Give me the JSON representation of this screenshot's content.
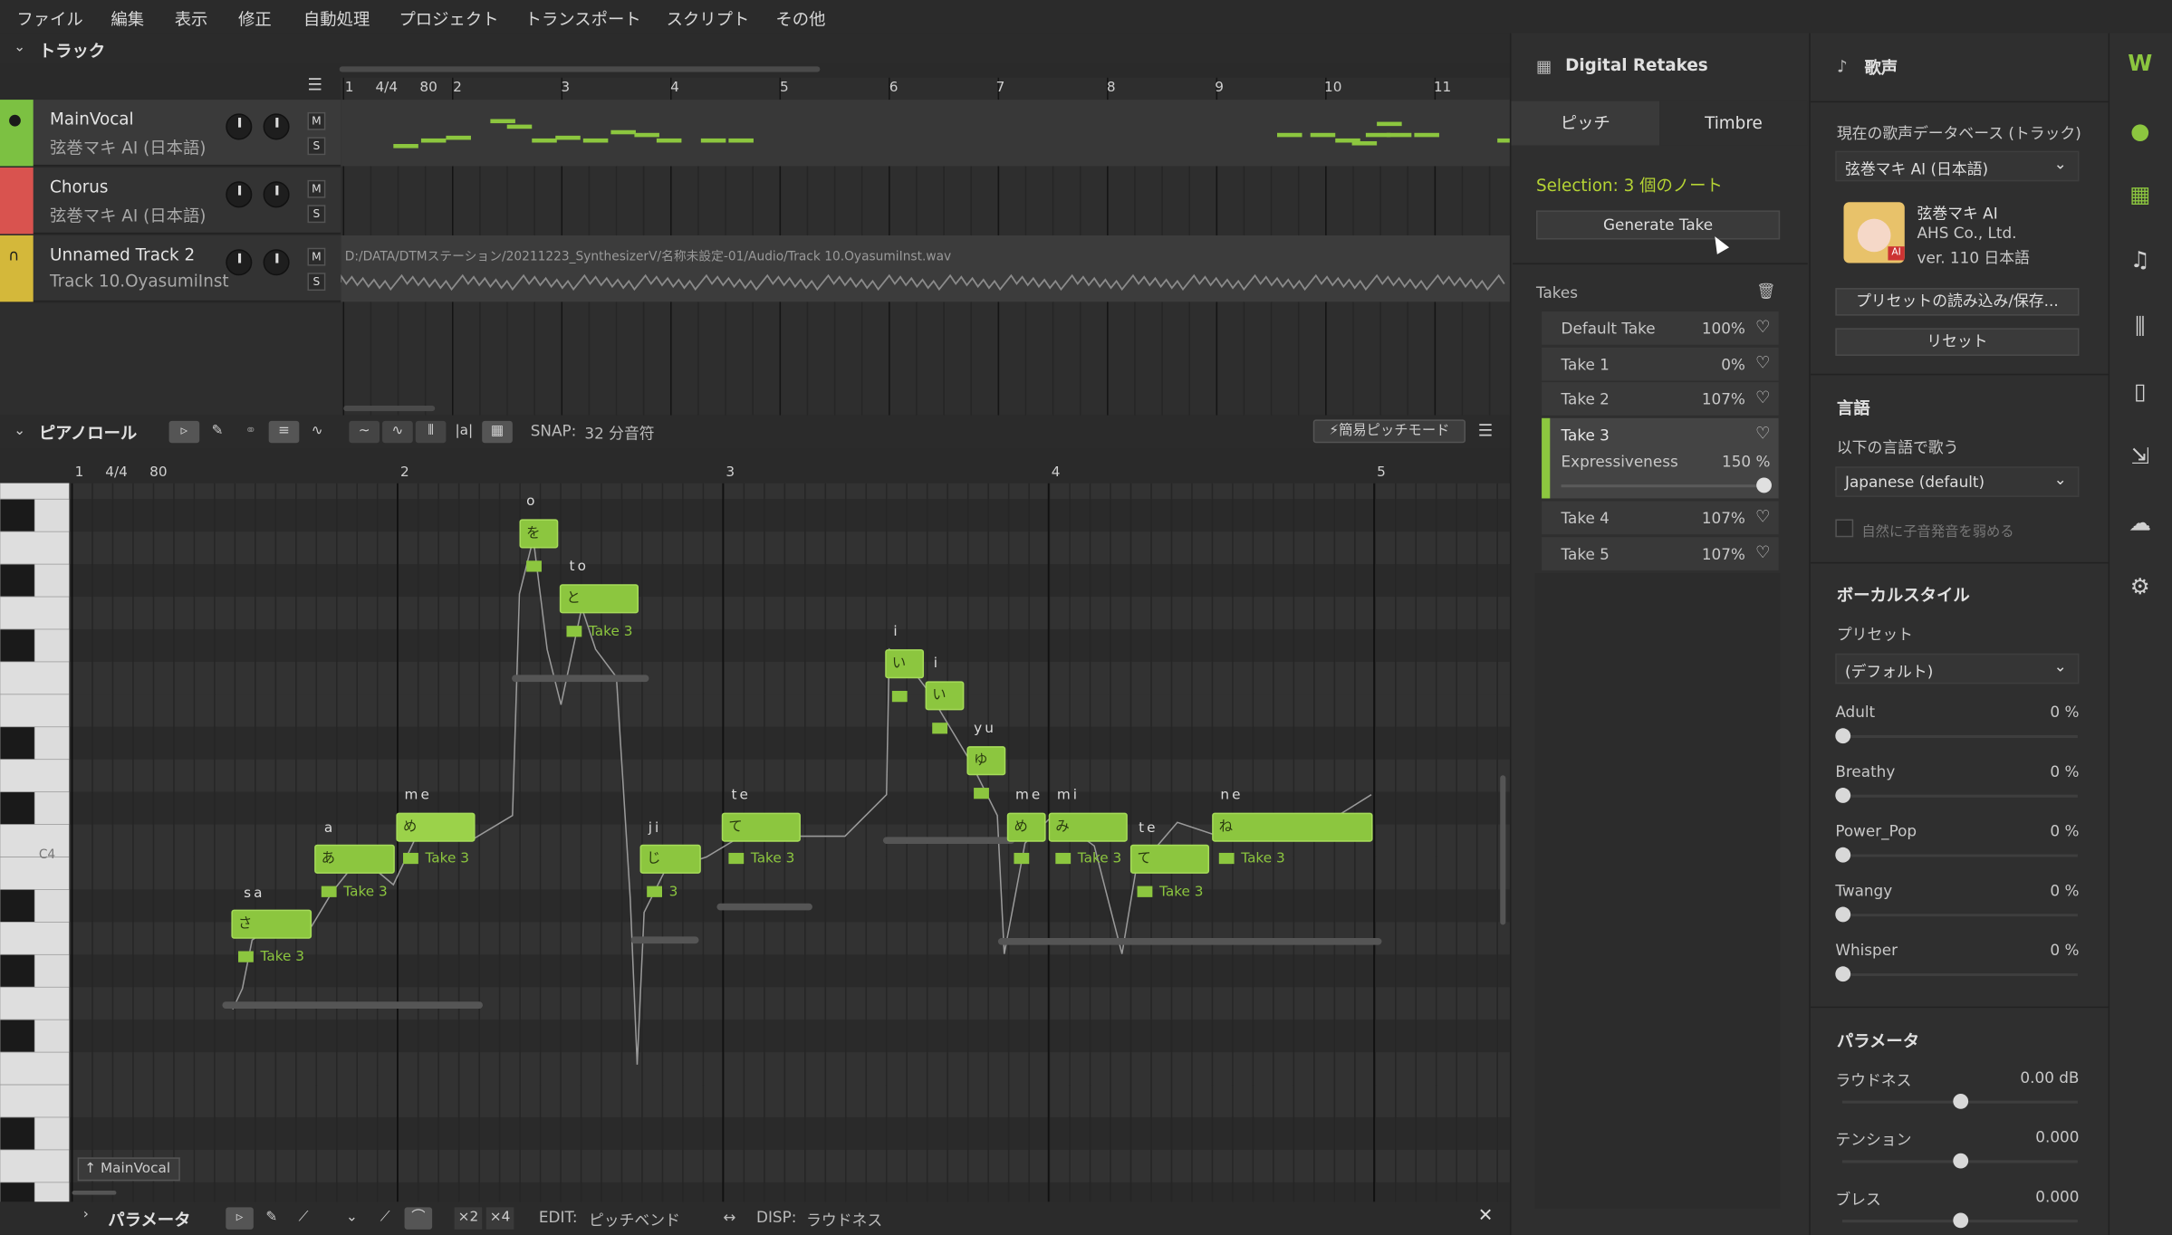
{
  "menu": [
    "ファイル",
    "編集",
    "表示",
    "修正",
    "自動処理",
    "プロジェクト",
    "トランスポート",
    "スクリプト",
    "その他"
  ],
  "tracks_section": {
    "title": "トラック"
  },
  "ruler_top": {
    "labels": [
      "1",
      "4/4",
      "80",
      "2",
      "3",
      "4",
      "5",
      "6",
      "7",
      "8",
      "9",
      "10",
      "11"
    ]
  },
  "tracks": [
    {
      "name": "MainVocal",
      "voice": "弦巻マキ AI (日本語)",
      "color": "#7cc142"
    },
    {
      "name": "Chorus",
      "voice": "弦巻マキ AI (日本語)",
      "color": "#d9534f"
    },
    {
      "name": "Unnamed Track 2",
      "voice": "Track 10.OyasumiInst",
      "color": "#d4b83a"
    }
  ],
  "track_ms": {
    "m": "M",
    "s": "S"
  },
  "audio_path": "D:/DATA/DTMステーション/20211223_SynthesizerV/名称未設定-01/Audio/Track 10.OyasumiInst.wav",
  "piano_roll": {
    "title": "ピアノロール",
    "snap_label": "SNAP:",
    "snap_value": "32 分音符",
    "easy_pitch": "簡易ピッチモード",
    "c4": "C4",
    "track_tag": "MainVocal",
    "ruler": [
      "1",
      "4/4",
      "80",
      "2",
      "3",
      "4",
      "5"
    ]
  },
  "notes": [
    {
      "lyric": "sa",
      "char": "さ",
      "take": "Take 3"
    },
    {
      "lyric": "a",
      "char": "あ",
      "take": "Take 3"
    },
    {
      "lyric": "me",
      "char": "め",
      "take": "Take 3"
    },
    {
      "lyric": "o",
      "char": "を",
      "take": ""
    },
    {
      "lyric": "to",
      "char": "と",
      "take": "Take 3"
    },
    {
      "lyric": "ji",
      "char": "じ",
      "take": "3"
    },
    {
      "lyric": "te",
      "char": "て",
      "take": "Take 3"
    },
    {
      "lyric": "i",
      "char": "い",
      "take": ""
    },
    {
      "lyric": "i",
      "char": "い",
      "take": ""
    },
    {
      "lyric": "yu",
      "char": "ゆ",
      "take": ""
    },
    {
      "lyric": "me",
      "char": "め",
      "take": ""
    },
    {
      "lyric": "mi",
      "char": "み",
      "take": "Take 3"
    },
    {
      "lyric": "te",
      "char": "て",
      "take": "Take 3"
    },
    {
      "lyric": "ne",
      "char": "ね",
      "take": "Take 3"
    }
  ],
  "params_bar": {
    "title": "パラメータ",
    "x2": "×2",
    "x4": "×4",
    "edit_label": "EDIT:",
    "edit_value": "ピッチベンド",
    "disp_label": "DISP:",
    "disp_value": "ラウドネス",
    "close": "✕"
  },
  "retakes": {
    "title": "Digital Retakes",
    "tab_pitch": "ピッチ",
    "tab_timbre": "Timbre",
    "selection": "Selection: 3 個のノート",
    "generate": "Generate Take",
    "takes_label": "Takes",
    "takes": [
      {
        "name": "Default Take",
        "value": "100%"
      },
      {
        "name": "Take 1",
        "value": "0%"
      },
      {
        "name": "Take 2",
        "value": "107%"
      },
      {
        "name": "Take 3",
        "value": ""
      },
      {
        "name": "Take 4",
        "value": "107%"
      },
      {
        "name": "Take 5",
        "value": "107%"
      }
    ],
    "expressiveness_label": "Expressiveness",
    "expressiveness_value": "150 %",
    "expressiveness_level": 1.0
  },
  "voice": {
    "title": "歌声",
    "db_label": "現在の歌声データベース (トラック)",
    "db_value": "弦巻マキ AI (日本語)",
    "singer_name": "弦巻マキ AI",
    "singer_company": "AHS Co., Ltd.",
    "singer_version": "ver. 110 日本語",
    "avatar_badge": "AI",
    "preset_btn": "プリセットの読み込み/保存...",
    "reset_btn": "リセット",
    "lang_title": "言語",
    "lang_label": "以下の言語で歌う",
    "lang_value": "Japanese (default)",
    "weaken_label": "自然に子音発音を弱める",
    "style_title": "ボーカルスタイル",
    "preset_label": "プリセット",
    "preset_value": "(デフォルト)",
    "styles": [
      {
        "name": "Adult",
        "value": "0 %",
        "level": 0
      },
      {
        "name": "Breathy",
        "value": "0 %",
        "level": 0
      },
      {
        "name": "Power_Pop",
        "value": "0 %",
        "level": 0
      },
      {
        "name": "Twangy",
        "value": "0 %",
        "level": 0
      },
      {
        "name": "Whisper",
        "value": "0 %",
        "level": 0
      }
    ],
    "param_title": "パラメータ",
    "params": [
      {
        "name": "ラウドネス",
        "value": "0.00 dB",
        "level": 0.5
      },
      {
        "name": "テンション",
        "value": "0.000",
        "level": 0.5
      },
      {
        "name": "ブレス",
        "value": "0.000",
        "level": 0.5
      }
    ]
  },
  "colors": {
    "accent": "#8cc63f",
    "selection_text": "#b5d334"
  }
}
